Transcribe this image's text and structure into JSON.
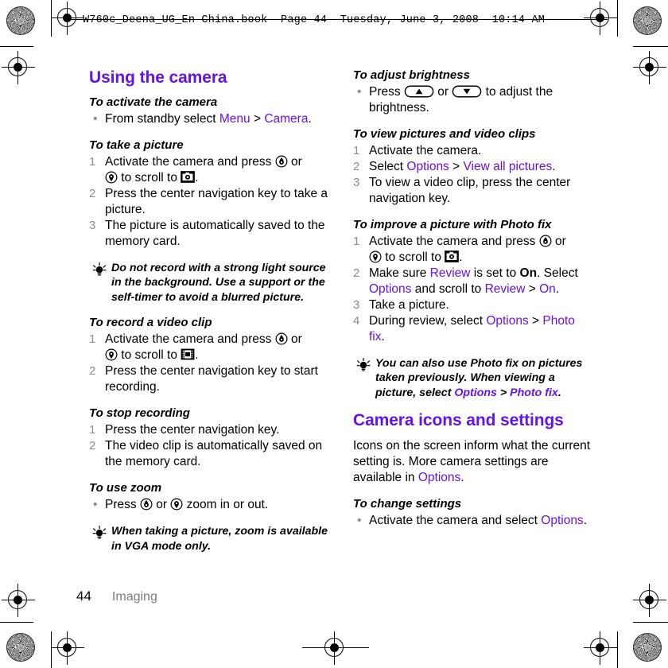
{
  "meta": {
    "accent_color": "#6312f0",
    "muted_color": "#8d8d8d",
    "header_slug": "W760c_Deena_UG_En China.book  Page 44  Tuesday, June 3, 2008  10:14 AM"
  },
  "footer": {
    "page_number": "44",
    "chapter": "Imaging"
  },
  "left_column": {
    "section_title": "Using the camera",
    "proc_activate": {
      "heading": "To activate the camera",
      "bullet_1_a": "From standby select ",
      "bullet_1_link1": "Menu",
      "bullet_1_sep": " > ",
      "bullet_1_link2": "Camera",
      "bullet_1_end": "."
    },
    "proc_take_picture": {
      "heading": "To take a picture",
      "step1_a": "Activate the camera and press ",
      "step1_b": " or ",
      "step1_c": " to scroll to ",
      "step1_d": ".",
      "step2": "Press the center navigation key to take a picture.",
      "step3": "The picture is automatically saved to the memory card."
    },
    "tip_light": "Do not record with a strong light source in the background. Use a support or the self-timer to avoid a blurred picture.",
    "proc_record_video": {
      "heading": "To record a video clip",
      "step1_a": "Activate the camera and press ",
      "step1_b": " or ",
      "step1_c": " to scroll to ",
      "step1_d": ".",
      "step2": "Press the center navigation key to start recording."
    },
    "proc_stop_recording": {
      "heading": "To stop recording",
      "step1": "Press the center navigation key.",
      "step2": "The video clip is automatically saved on the memory card."
    },
    "proc_use_zoom": {
      "heading": "To use zoom",
      "bullet_a": "Press ",
      "bullet_b": " or ",
      "bullet_c": " zoom in or out."
    },
    "tip_zoom": "When taking a picture, zoom is available in VGA mode only."
  },
  "right_column": {
    "proc_brightness": {
      "heading": "To adjust brightness",
      "bullet_a": "Press ",
      "bullet_b": " or ",
      "bullet_c": " to adjust the brightness."
    },
    "proc_view_pictures": {
      "heading": "To view pictures and video clips",
      "step1": "Activate the camera.",
      "step2_a": "Select ",
      "step2_link1": "Options",
      "step2_sep": " > ",
      "step2_link2": "View all pictures",
      "step2_end": ".",
      "step3": "To view a video clip, press the center navigation key."
    },
    "proc_photo_fix": {
      "heading": "To improve a picture with Photo fix",
      "step1_a": "Activate the camera and press ",
      "step1_b": " or ",
      "step1_c": " to scroll to ",
      "step1_d": ".",
      "step2_a": "Make sure ",
      "step2_link1": "Review",
      "step2_b": " is set to ",
      "step2_bold": "On",
      "step2_c": ". Select ",
      "step2_link2": "Options",
      "step2_d": " and scroll to ",
      "step2_link3": "Review",
      "step2_sep": " > ",
      "step2_link4": "On",
      "step2_end": ".",
      "step3": "Take a picture.",
      "step4_a": "During review, select ",
      "step4_link1": "Options",
      "step4_sep": " > ",
      "step4_link2": "Photo fix",
      "step4_end": "."
    },
    "tip_photo_fix": {
      "part1": "You can also use Photo fix on pictures taken previously. When viewing a picture, select ",
      "link1": "Options",
      "sep": " > ",
      "link2": "Photo fix",
      "end": "."
    },
    "section_title": "Camera icons and settings",
    "intro_a": "Icons on the screen inform what the current setting is. More camera settings are available in ",
    "intro_link": "Options",
    "intro_end": ".",
    "proc_change_settings": {
      "heading": "To change settings",
      "bullet_a": "Activate the camera and select ",
      "bullet_link": "Options",
      "bullet_end": "."
    }
  },
  "icons": {
    "nav_up": "nav-key-up-icon",
    "nav_down": "nav-key-down-icon",
    "camera_mode": "camera-mode-icon",
    "video_mode": "video-mode-icon",
    "brightness_up": "brightness-up-button-icon",
    "brightness_down": "brightness-down-button-icon",
    "tip_bulb": "tip-lightbulb-icon"
  }
}
